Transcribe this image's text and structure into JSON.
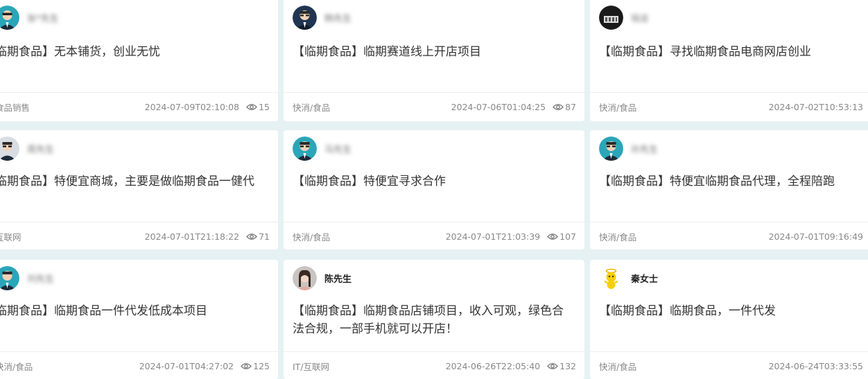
{
  "cards": [
    {
      "user": "张*先生",
      "title": "临期食品】无本铺货，创业无忧",
      "category": "食品销售",
      "date": "2024-07-09T02:10:08",
      "views": "15",
      "avatar": "suit-teal",
      "blurred": true
    },
    {
      "user": "韩先生",
      "title": "【临期食品】临期赛道线上开店项目",
      "category": "快消/食品",
      "date": "2024-07-06T01:04:25",
      "views": "87",
      "avatar": "suit-navy",
      "blurred": true
    },
    {
      "user": "钱总",
      "title": "【临期食品】寻找临期食品电商网店创业",
      "category": "快消/食品",
      "date": "2024-07-02T10:53:13",
      "views": "",
      "avatar": "photo-dark",
      "blurred": true
    },
    {
      "user": "周先生",
      "title": "临期食品】特便宜商城，主要是做临期食品一健代",
      "category": "互联网",
      "date": "2024-07-01T21:18:22",
      "views": "71",
      "avatar": "suit-gray",
      "blurred": true
    },
    {
      "user": "马先生",
      "title": "【临期食品】特便宜寻求合作",
      "category": "快消/食品",
      "date": "2024-07-01T21:03:39",
      "views": "107",
      "avatar": "suit-teal",
      "blurred": true
    },
    {
      "user": "孙先生",
      "title": "【临期食品】特便宜临期食品代理，全程陪跑",
      "category": "快消/食品",
      "date": "2024-07-01T09:16:49",
      "views": "",
      "avatar": "suit-teal",
      "blurred": true
    },
    {
      "user": "刘先生",
      "title": "临期食品】临期食品一件代发低成本项目",
      "category": "快消/食品",
      "date": "2024-07-01T04:27:02",
      "views": "125",
      "avatar": "suit-teal",
      "blurred": true
    },
    {
      "user": "陈先生",
      "title": "【临期食品】临期食品店铺项目，收入可观，绿色合法合规，一部手机就可以开店！",
      "category": "IT/互联网",
      "date": "2024-06-26T22:05:40",
      "views": "132",
      "avatar": "photo-girl",
      "blurred": false
    },
    {
      "user": "秦女士",
      "title": "【临期食品】临期食品，一件代发",
      "category": "快消/食品",
      "date": "2024-06-24T03:33:55",
      "views": "",
      "avatar": "cartoon-yellow",
      "blurred": false
    }
  ],
  "colors": {
    "background": "#e6f1f3",
    "card": "#ffffff",
    "text": "#333333",
    "muted": "#888888"
  },
  "icons": {
    "views": "eye-icon"
  }
}
